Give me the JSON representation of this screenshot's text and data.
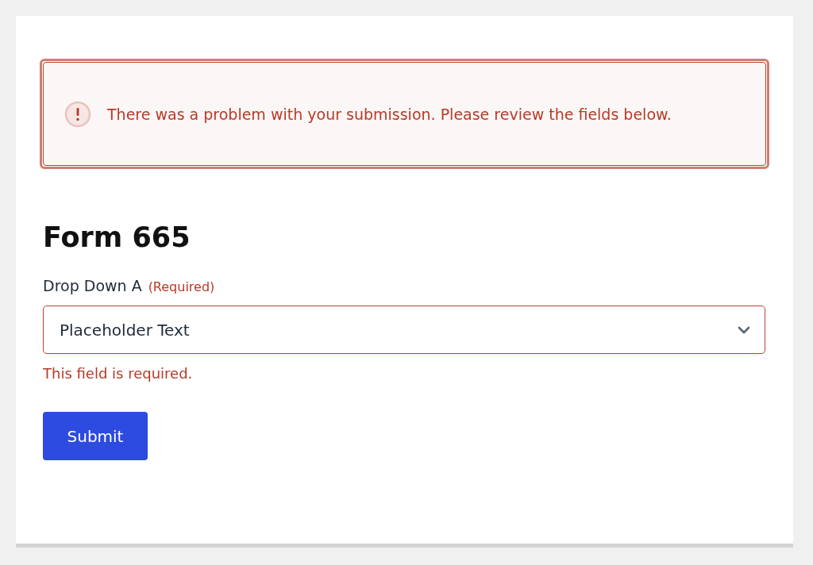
{
  "alert": {
    "message": "There was a problem with your submission. Please review the fields below."
  },
  "form": {
    "title": "Form 665",
    "fields": [
      {
        "kind": "select",
        "label": "Drop Down A",
        "required_note": "(Required)",
        "placeholder": "Placeholder Text",
        "invalid": true,
        "error": "This field is required."
      }
    ],
    "submit": {
      "label": "Submit"
    }
  }
}
